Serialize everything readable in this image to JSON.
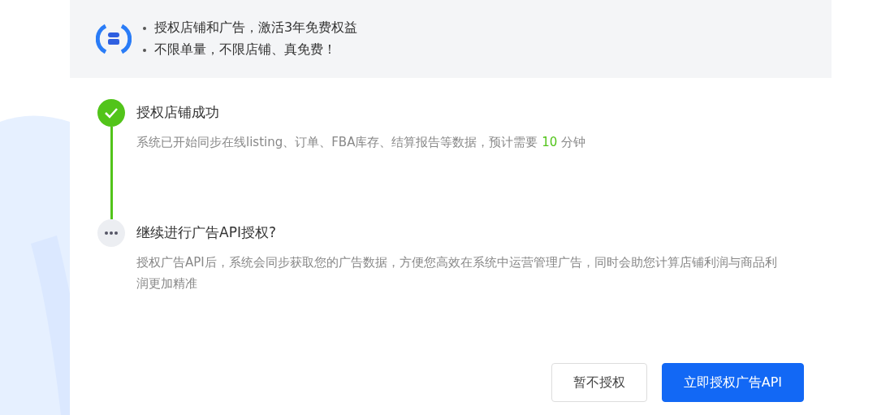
{
  "banner": {
    "bullets": [
      "授权店铺和广告，激活3年免费权益",
      "不限单量，不限店铺、真免费！"
    ]
  },
  "steps": [
    {
      "kind": "done",
      "title": "授权店铺成功",
      "description": {
        "before": "系统已开始同步在线listing、订单、FBA库存、结算报告等数据，预计需要 ",
        "highlight": "10",
        "after": " 分钟"
      }
    },
    {
      "kind": "pending",
      "title": "继续进行广告API授权?",
      "description": {
        "before": "授权广告API后，系统会同步获取您的广告数据，方便您高效在系统中运营管理广告，同时会助您计算店铺利润与商品利润更加精准"
      }
    }
  ],
  "buttons": [
    {
      "kind": "secondary",
      "label": "暂不授权"
    },
    {
      "kind": "primary",
      "label": "立即授权广告API"
    }
  ]
}
